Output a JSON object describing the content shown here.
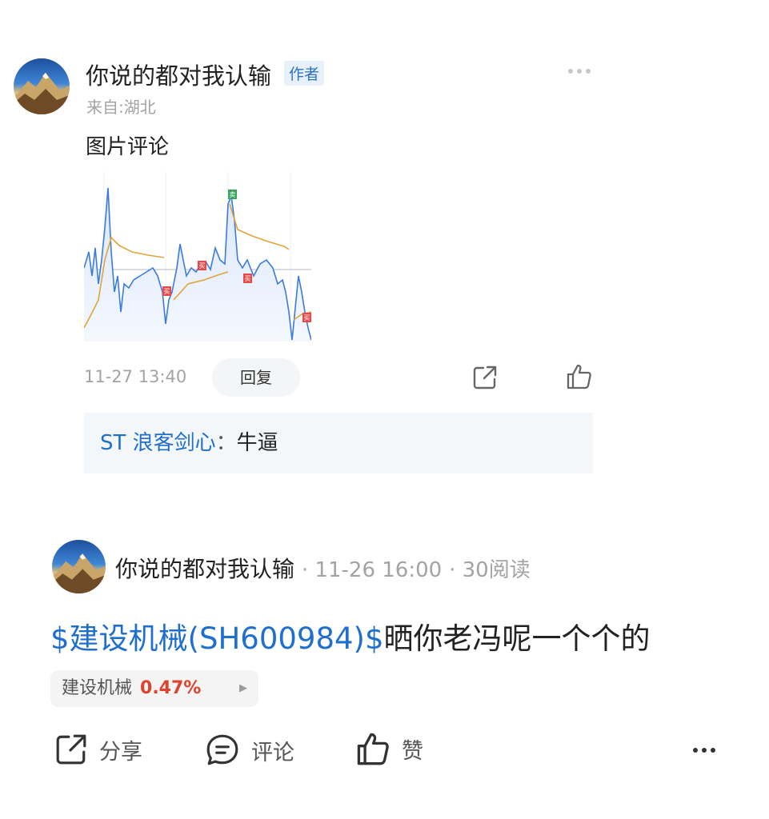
{
  "reply": {
    "author": "你说的都对我认输",
    "badge": "作者",
    "location": "来自:湖北",
    "text": "图片评论",
    "time": "11-27 13:40",
    "reply_button": "回复",
    "nested_comment": {
      "user": "ST 浪客剑心",
      "separator": "：",
      "text": "牛逼"
    },
    "chart_markers": [
      "卖",
      "买",
      "买",
      "买",
      "买"
    ]
  },
  "post": {
    "author": "你说的都对我认输",
    "time": "· 11-26 16:00",
    "reads": "· 30阅读",
    "stock_tag": "$建设机械(SH600984)$",
    "text": "晒你老冯呢一个个的",
    "stock_chip": {
      "name": "建设机械",
      "change": "0.47%",
      "change_color": "#e0432c"
    },
    "actions": {
      "share": "分享",
      "comment": "评论",
      "like": "赞"
    }
  },
  "colors": {
    "link_blue": "#1f6fcf",
    "price_line": "#3a7be0",
    "avg_line": "#e0a53a"
  }
}
